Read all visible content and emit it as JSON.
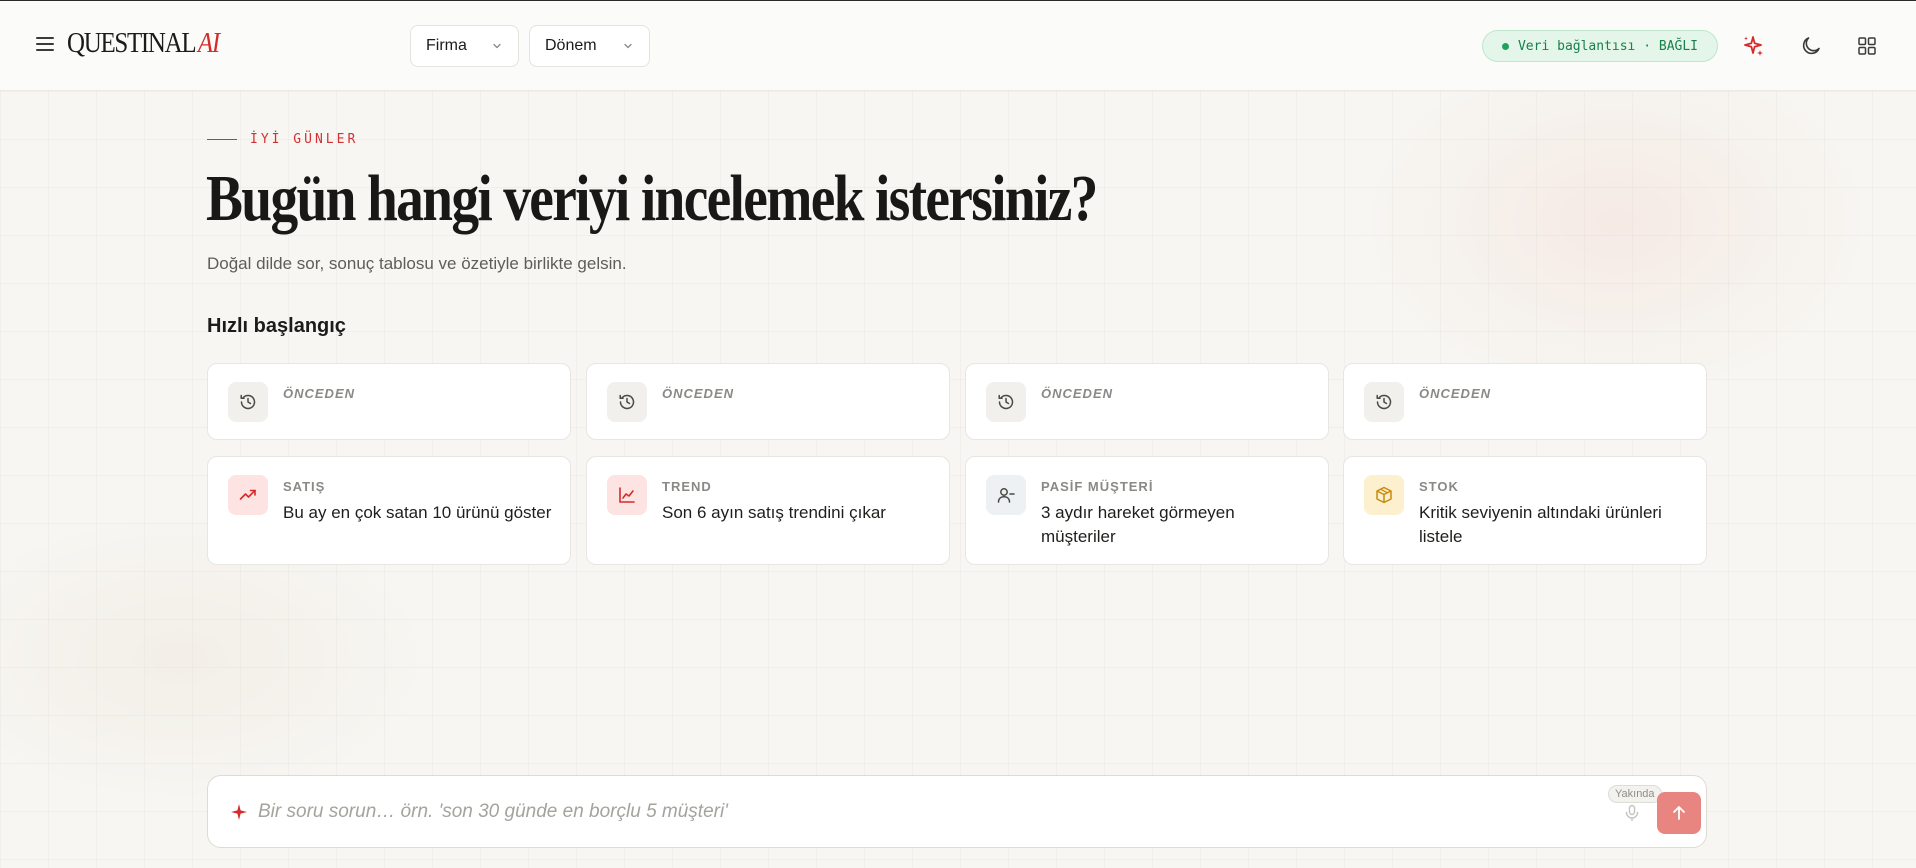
{
  "header": {
    "logo_main": "QUESTINAL",
    "logo_accent": "AI",
    "firma_label": "Firma",
    "donem_label": "Dönem",
    "connection_status": "Veri bağlantısı · BAĞLI",
    "icons": [
      "menu-icon",
      "sparkle-icon",
      "moon-icon",
      "grid-icon"
    ]
  },
  "main": {
    "eyebrow": "İYİ GÜNLER",
    "headline": "Bugün hangi veriyi incelemek istersiniz?",
    "subtitle": "Doğal dilde sor, sonuç tablosu ve özetiyle birlikte gelsin.",
    "section_title": "Hızlı başlangıç",
    "recent_cards": [
      {
        "category": "ÖNCEDEN",
        "text": ""
      },
      {
        "category": "ÖNCEDEN",
        "text": ""
      },
      {
        "category": "ÖNCEDEN",
        "text": ""
      },
      {
        "category": "ÖNCEDEN",
        "text": ""
      }
    ],
    "quick_cards": [
      {
        "category": "SATIŞ",
        "text": "Bu ay en çok satan 10 ürünü göster",
        "icon": "trending-up-icon"
      },
      {
        "category": "TREND",
        "text": "Son 6 ayın satış trendini çıkar",
        "icon": "line-chart-icon"
      },
      {
        "category": "PASİF MÜŞTERİ",
        "text": "3 aydır hareket görmeyen müşteriler",
        "icon": "user-minus-icon"
      },
      {
        "category": "STOK",
        "text": "Kritik seviyenin altındaki ürünleri listele",
        "icon": "package-icon"
      }
    ]
  },
  "composer": {
    "placeholder": "Bir soru sorun… örn. 'son 30 günde en borçlu 5 müşteri'",
    "soon_badge": "Yakında"
  },
  "colors": {
    "accent": "#d62b2b",
    "connected_bg": "#e4f5ea",
    "connected_text": "#18804a",
    "send_button": "#e98580"
  }
}
